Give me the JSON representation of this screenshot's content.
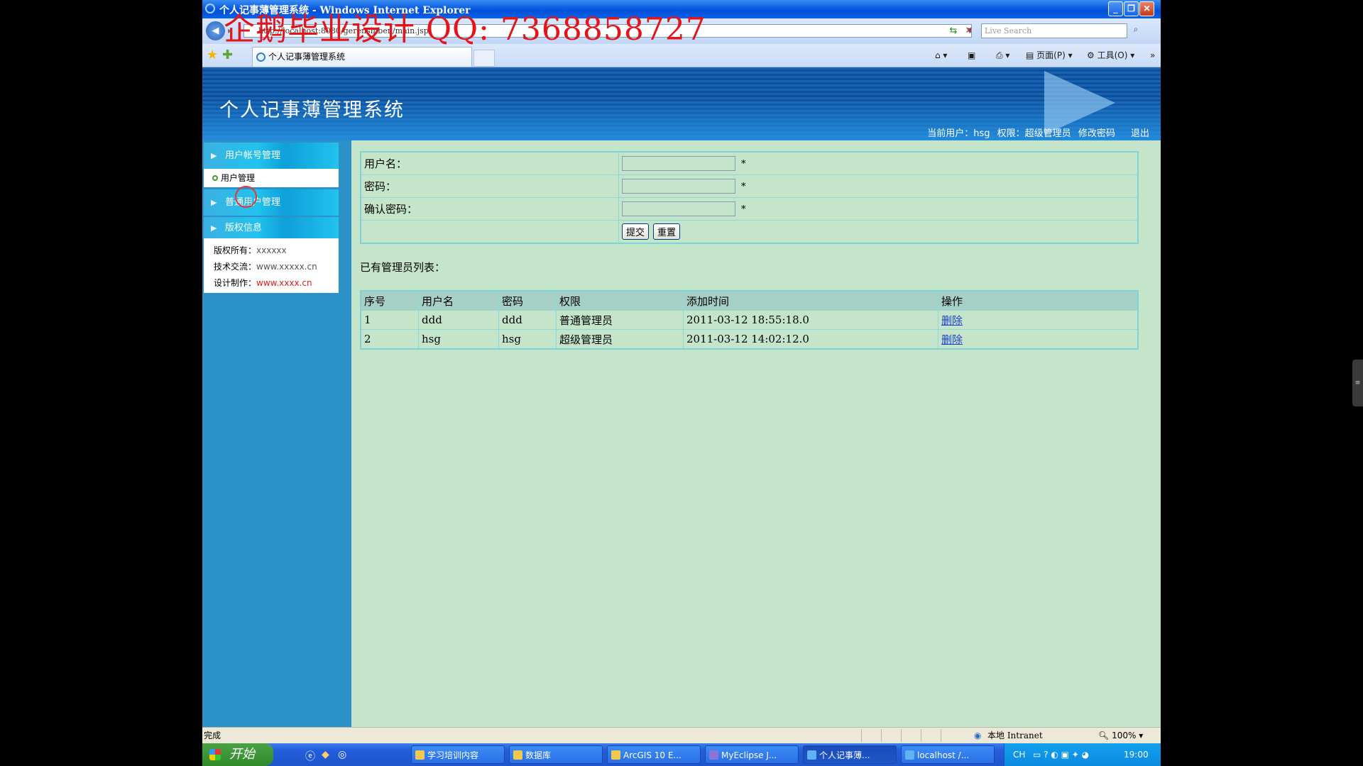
{
  "window": {
    "title": "个人记事薄管理系统 - Windows Internet Explorer"
  },
  "watermark": "企鹅毕业设计 QQ: 7368858727",
  "browser": {
    "url": "http://localhost:8080/gerenshiben/main.jsp",
    "search_placeholder": "Live Search",
    "tab_label": "个人记事薄管理系统",
    "tools": {
      "page": "页面(P)",
      "tools": "工具(O)"
    }
  },
  "header": {
    "title": "个人记事薄管理系统",
    "current_user_label": "当前用户：hsg",
    "role_label": "权限：超级管理员",
    "change_password": "修改密码",
    "logout": "退出"
  },
  "sidebar": {
    "sections": [
      {
        "label": "用户帐号管理",
        "items": [
          "用户管理"
        ]
      },
      {
        "label": "普通用户管理"
      },
      {
        "label": "版权信息"
      }
    ],
    "info": [
      {
        "key": "版权所有：",
        "value": "xxxxxx"
      },
      {
        "key": "技术交流：",
        "value": "www.xxxxx.cn"
      },
      {
        "key": "设计制作：",
        "value": "www.xxxx.cn"
      }
    ]
  },
  "form": {
    "username_label": "用户名：",
    "password_label": "密码：",
    "confirm_label": "确认密码：",
    "required_mark": "*",
    "submit": "提交",
    "reset": "重置"
  },
  "list": {
    "title": "已有管理员列表：",
    "columns": [
      "序号",
      "用户名",
      "密码",
      "权限",
      "添加时间",
      "操作"
    ],
    "rows": [
      [
        "1",
        "ddd",
        "ddd",
        "普通管理员",
        "2011-03-12 18:55:18.0",
        "删除"
      ],
      [
        "2",
        "hsg",
        "hsg",
        "超级管理员",
        "2011-03-12 14:02:12.0",
        "删除"
      ]
    ]
  },
  "status": {
    "text": "完成",
    "zone": "本地 Intranet",
    "zoom": "100%"
  },
  "taskbar": {
    "start": "开始",
    "tasks": [
      "学习培训内容",
      "数据库",
      "ArcGIS 10 E...",
      "MyEclipse J...",
      "个人记事薄...",
      "localhost /..."
    ],
    "lang": "CH",
    "clock": "19:00"
  }
}
